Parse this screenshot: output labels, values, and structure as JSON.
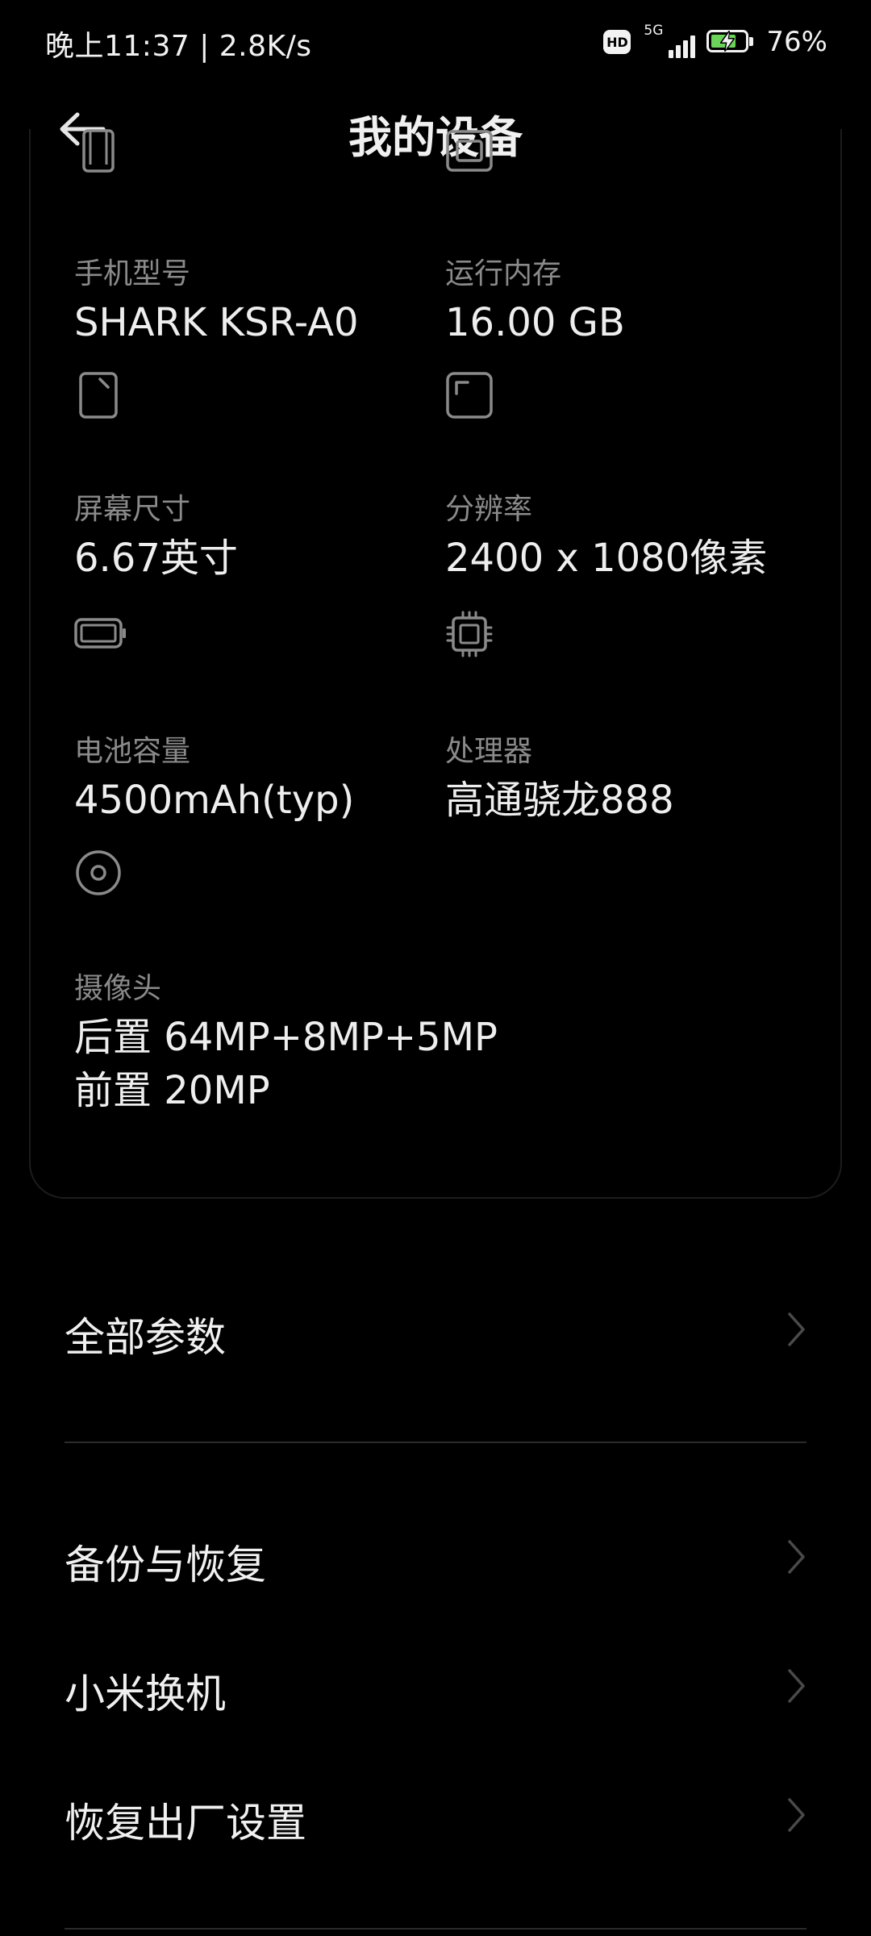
{
  "status_bar": {
    "time_speed": "晚上11:37 | 2.8K/s",
    "hd": "HD",
    "network": "5G",
    "battery_percent": "76%",
    "battery_level": 0.76,
    "battery_charging": true
  },
  "header": {
    "title": "我的设备",
    "back_icon": "arrow-left-icon"
  },
  "specs": [
    {
      "icon": "phone-icon",
      "label": "手机型号",
      "value": "SHARK KSR-A0"
    },
    {
      "icon": "memory-icon",
      "label": "运行内存",
      "value": "16.00 GB"
    },
    {
      "icon": "screen-size-icon",
      "label": "屏幕尺寸",
      "value": "6.67英寸"
    },
    {
      "icon": "resolution-icon",
      "label": "分辨率",
      "value": "2400 x 1080像素"
    },
    {
      "icon": "battery-icon",
      "label": "电池容量",
      "value": "4500mAh(typ)"
    },
    {
      "icon": "processor-icon",
      "label": "处理器",
      "value": "高通骁龙888"
    },
    {
      "icon": "camera-icon",
      "label": "摄像头",
      "value_line1": "后置 64MP+8MP+5MP",
      "value_line2": "前置 20MP"
    }
  ],
  "settings": {
    "all_params": "全部参数",
    "backup_restore": "备份与恢复",
    "mi_mover": "小米换机",
    "factory_reset": "恢复出厂设置"
  },
  "colors": {
    "background": "#000000",
    "text_primary": "#f0f0f0",
    "text_secondary": "#8a8a8a",
    "battery_fill": "#6bd35a"
  }
}
